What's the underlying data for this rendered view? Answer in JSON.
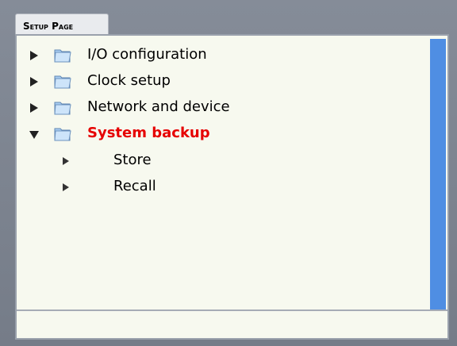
{
  "tab": {
    "label": "Setup Page"
  },
  "colors": {
    "frame": "#7e8591",
    "panel_background": "#f7f9ef",
    "scrollbar": "#4f8ee3",
    "selected_text": "#e60000"
  },
  "tree": {
    "items": [
      {
        "label": "I/O configuration",
        "expanded": false,
        "selected": false
      },
      {
        "label": "Clock setup",
        "expanded": false,
        "selected": false
      },
      {
        "label": "Network and device",
        "expanded": false,
        "selected": false
      },
      {
        "label": "System backup",
        "expanded": true,
        "selected": true,
        "children": [
          {
            "label": "Store"
          },
          {
            "label": "Recall"
          }
        ]
      }
    ]
  },
  "status": {
    "text": ""
  }
}
